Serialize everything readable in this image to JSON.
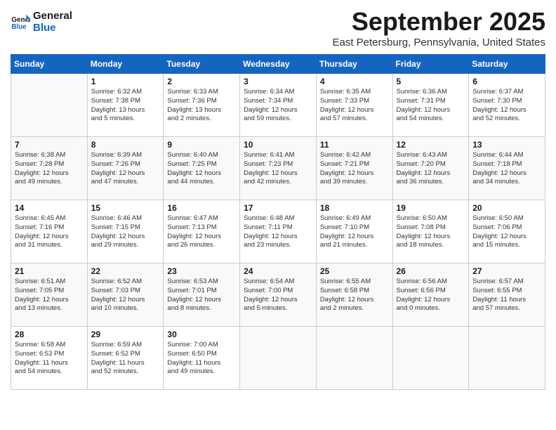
{
  "logo": {
    "line1": "General",
    "line2": "Blue"
  },
  "title": "September 2025",
  "location": "East Petersburg, Pennsylvania, United States",
  "weekdays": [
    "Sunday",
    "Monday",
    "Tuesday",
    "Wednesday",
    "Thursday",
    "Friday",
    "Saturday"
  ],
  "weeks": [
    [
      {
        "day": "",
        "info": ""
      },
      {
        "day": "1",
        "info": "Sunrise: 6:32 AM\nSunset: 7:38 PM\nDaylight: 13 hours\nand 5 minutes."
      },
      {
        "day": "2",
        "info": "Sunrise: 6:33 AM\nSunset: 7:36 PM\nDaylight: 13 hours\nand 2 minutes."
      },
      {
        "day": "3",
        "info": "Sunrise: 6:34 AM\nSunset: 7:34 PM\nDaylight: 12 hours\nand 59 minutes."
      },
      {
        "day": "4",
        "info": "Sunrise: 6:35 AM\nSunset: 7:33 PM\nDaylight: 12 hours\nand 57 minutes."
      },
      {
        "day": "5",
        "info": "Sunrise: 6:36 AM\nSunset: 7:31 PM\nDaylight: 12 hours\nand 54 minutes."
      },
      {
        "day": "6",
        "info": "Sunrise: 6:37 AM\nSunset: 7:30 PM\nDaylight: 12 hours\nand 52 minutes."
      }
    ],
    [
      {
        "day": "7",
        "info": "Sunrise: 6:38 AM\nSunset: 7:28 PM\nDaylight: 12 hours\nand 49 minutes."
      },
      {
        "day": "8",
        "info": "Sunrise: 6:39 AM\nSunset: 7:26 PM\nDaylight: 12 hours\nand 47 minutes."
      },
      {
        "day": "9",
        "info": "Sunrise: 6:40 AM\nSunset: 7:25 PM\nDaylight: 12 hours\nand 44 minutes."
      },
      {
        "day": "10",
        "info": "Sunrise: 6:41 AM\nSunset: 7:23 PM\nDaylight: 12 hours\nand 42 minutes."
      },
      {
        "day": "11",
        "info": "Sunrise: 6:42 AM\nSunset: 7:21 PM\nDaylight: 12 hours\nand 39 minutes."
      },
      {
        "day": "12",
        "info": "Sunrise: 6:43 AM\nSunset: 7:20 PM\nDaylight: 12 hours\nand 36 minutes."
      },
      {
        "day": "13",
        "info": "Sunrise: 6:44 AM\nSunset: 7:18 PM\nDaylight: 12 hours\nand 34 minutes."
      }
    ],
    [
      {
        "day": "14",
        "info": "Sunrise: 6:45 AM\nSunset: 7:16 PM\nDaylight: 12 hours\nand 31 minutes."
      },
      {
        "day": "15",
        "info": "Sunrise: 6:46 AM\nSunset: 7:15 PM\nDaylight: 12 hours\nand 29 minutes."
      },
      {
        "day": "16",
        "info": "Sunrise: 6:47 AM\nSunset: 7:13 PM\nDaylight: 12 hours\nand 26 minutes."
      },
      {
        "day": "17",
        "info": "Sunrise: 6:48 AM\nSunset: 7:11 PM\nDaylight: 12 hours\nand 23 minutes."
      },
      {
        "day": "18",
        "info": "Sunrise: 6:49 AM\nSunset: 7:10 PM\nDaylight: 12 hours\nand 21 minutes."
      },
      {
        "day": "19",
        "info": "Sunrise: 6:50 AM\nSunset: 7:08 PM\nDaylight: 12 hours\nand 18 minutes."
      },
      {
        "day": "20",
        "info": "Sunrise: 6:50 AM\nSunset: 7:06 PM\nDaylight: 12 hours\nand 15 minutes."
      }
    ],
    [
      {
        "day": "21",
        "info": "Sunrise: 6:51 AM\nSunset: 7:05 PM\nDaylight: 12 hours\nand 13 minutes."
      },
      {
        "day": "22",
        "info": "Sunrise: 6:52 AM\nSunset: 7:03 PM\nDaylight: 12 hours\nand 10 minutes."
      },
      {
        "day": "23",
        "info": "Sunrise: 6:53 AM\nSunset: 7:01 PM\nDaylight: 12 hours\nand 8 minutes."
      },
      {
        "day": "24",
        "info": "Sunrise: 6:54 AM\nSunset: 7:00 PM\nDaylight: 12 hours\nand 5 minutes."
      },
      {
        "day": "25",
        "info": "Sunrise: 6:55 AM\nSunset: 6:58 PM\nDaylight: 12 hours\nand 2 minutes."
      },
      {
        "day": "26",
        "info": "Sunrise: 6:56 AM\nSunset: 6:56 PM\nDaylight: 12 hours\nand 0 minutes."
      },
      {
        "day": "27",
        "info": "Sunrise: 6:57 AM\nSunset: 6:55 PM\nDaylight: 11 hours\nand 57 minutes."
      }
    ],
    [
      {
        "day": "28",
        "info": "Sunrise: 6:58 AM\nSunset: 6:53 PM\nDaylight: 11 hours\nand 54 minutes."
      },
      {
        "day": "29",
        "info": "Sunrise: 6:59 AM\nSunset: 6:52 PM\nDaylight: 11 hours\nand 52 minutes."
      },
      {
        "day": "30",
        "info": "Sunrise: 7:00 AM\nSunset: 6:50 PM\nDaylight: 11 hours\nand 49 minutes."
      },
      {
        "day": "",
        "info": ""
      },
      {
        "day": "",
        "info": ""
      },
      {
        "day": "",
        "info": ""
      },
      {
        "day": "",
        "info": ""
      }
    ]
  ]
}
